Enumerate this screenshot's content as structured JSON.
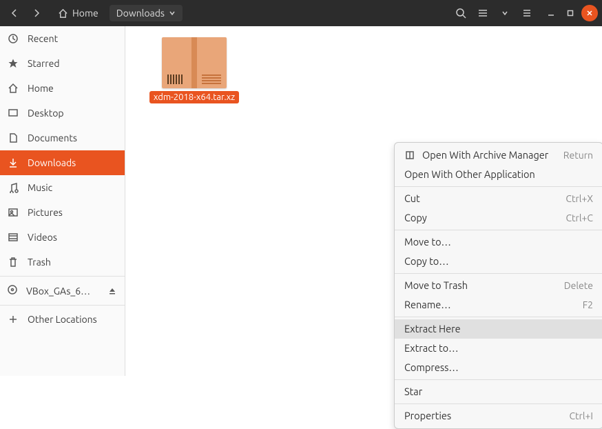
{
  "header": {
    "home_label": "Home",
    "current_label": "Downloads"
  },
  "sidebar": {
    "items": [
      {
        "label": "Recent"
      },
      {
        "label": "Starred"
      },
      {
        "label": "Home"
      },
      {
        "label": "Desktop"
      },
      {
        "label": "Documents"
      },
      {
        "label": "Downloads",
        "active": true
      },
      {
        "label": "Music"
      },
      {
        "label": "Pictures"
      },
      {
        "label": "Videos"
      },
      {
        "label": "Trash"
      }
    ],
    "mounts": [
      {
        "label": "VBox_GAs_6…"
      }
    ],
    "other_locations": "Other Locations"
  },
  "files": [
    {
      "name": "xdm-2018-x64.tar.xz",
      "selected": true
    }
  ],
  "context_menu": {
    "items": [
      {
        "label": "Open With Archive Manager",
        "accel": "Return",
        "icon": true
      },
      {
        "label": "Open With Other Application"
      },
      {
        "sep": true
      },
      {
        "label": "Cut",
        "accel": "Ctrl+X"
      },
      {
        "label": "Copy",
        "accel": "Ctrl+C"
      },
      {
        "sep": true
      },
      {
        "label": "Move to…"
      },
      {
        "label": "Copy to…"
      },
      {
        "sep": true
      },
      {
        "label": "Move to Trash",
        "accel": "Delete"
      },
      {
        "label": "Rename…",
        "accel": "F2"
      },
      {
        "sep": true
      },
      {
        "label": "Extract Here",
        "hover": true
      },
      {
        "label": "Extract to…"
      },
      {
        "label": "Compress…"
      },
      {
        "sep": true
      },
      {
        "label": "Star"
      },
      {
        "sep": true
      },
      {
        "label": "Properties",
        "accel": "Ctrl+I"
      }
    ]
  }
}
